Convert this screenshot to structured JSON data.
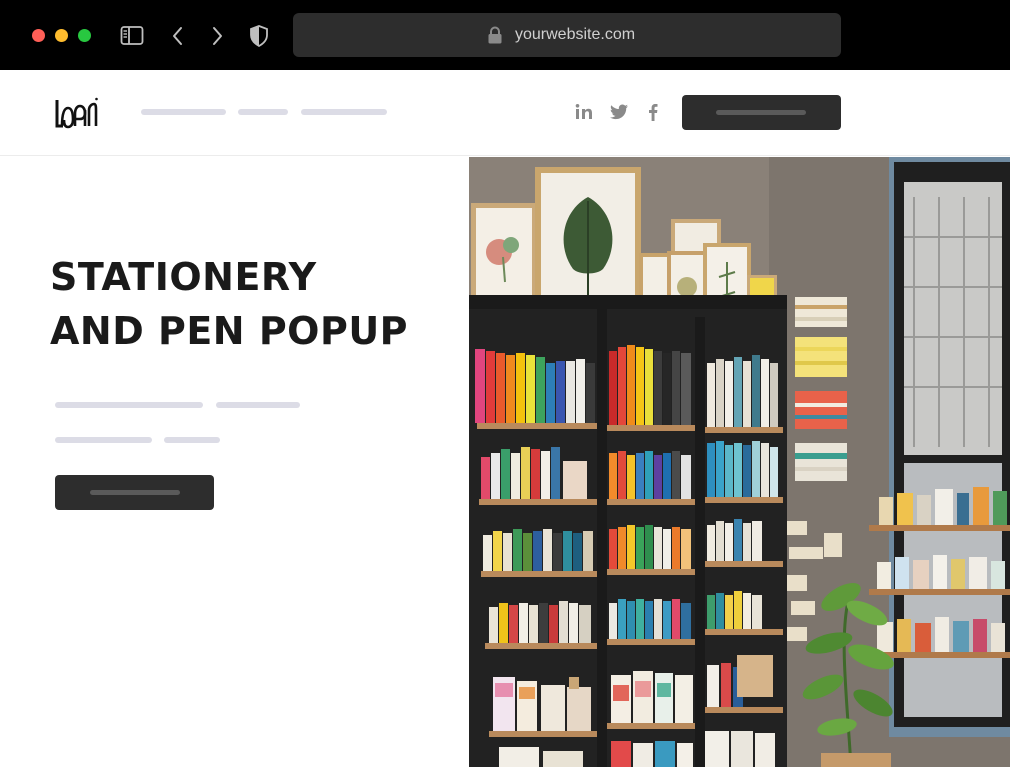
{
  "browser": {
    "url": "yourwebsite.com",
    "traffic_lights": [
      "#ff5f57",
      "#febc2e",
      "#28c840"
    ],
    "icons": [
      "sidebar-icon",
      "back-icon",
      "forward-icon",
      "shield-icon",
      "lock-icon"
    ]
  },
  "header": {
    "logo": "logo",
    "social_icons": [
      "linkedin-icon",
      "twitter-icon",
      "facebook-icon"
    ]
  },
  "hero": {
    "title_line1": "STATIONERY",
    "title_line2": "AND PEN POPUP"
  },
  "colors": {
    "dark_button": "#2d2d2d",
    "placeholder_bar": "#dcdce6",
    "title": "#1a1a1a"
  },
  "image": {
    "description_icon": "stationery-shop-photo"
  }
}
